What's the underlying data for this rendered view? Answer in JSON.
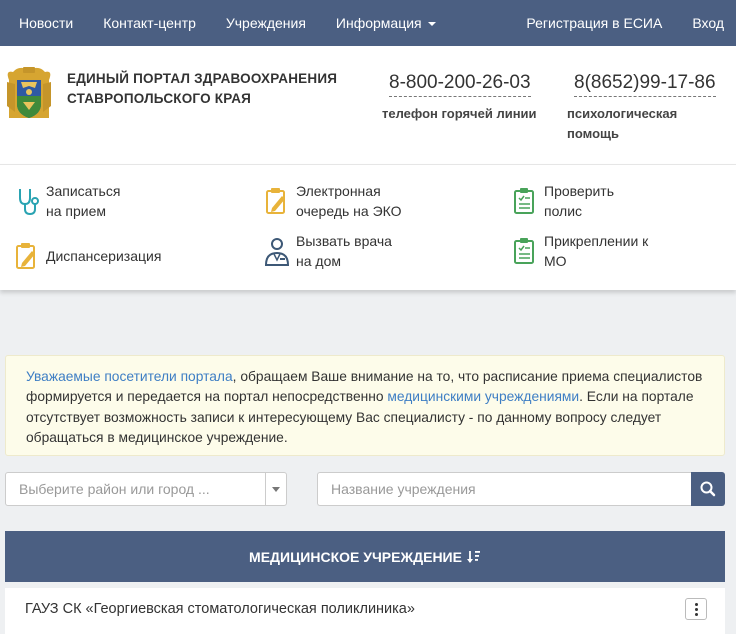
{
  "nav": {
    "items": [
      "Новости",
      "Контакт-центр",
      "Учреждения",
      "Информация"
    ],
    "registration": "Регистрация в ЕСИА",
    "login": "Вход"
  },
  "header": {
    "title_line1": "ЕДИНЫЙ ПОРТАЛ ЗДРАВООХРАНЕНИЯ",
    "title_line2": "СТАВРОПОЛЬСКОГО КРАЯ",
    "hotline_phone": "8-800-200-26-03",
    "hotline_caption": "телефон горячей линии",
    "psych_phone": "8(8652)99-17-86",
    "psych_caption_line1": "психологическая",
    "psych_caption_line2": "помощь"
  },
  "services": [
    {
      "line1": "Записаться",
      "line2": "на прием"
    },
    {
      "line1": "Электронная",
      "line2": "очередь на ЭКО"
    },
    {
      "line1": "Проверить",
      "line2": "полис"
    },
    {
      "line1": "Диспансеризация",
      "line2": ""
    },
    {
      "line1": "Вызвать врача",
      "line2": "на дом"
    },
    {
      "line1": "Прикреплении к",
      "line2": "МО"
    }
  ],
  "notice": {
    "link1": "Уважаемые посетители портала",
    "text1": ", обращаем Ваше внимание на то, что расписание приема специалистов формируется и передается на портал непосредственно ",
    "link2": "медицинскими учреждениями",
    "text2": ". Если на портале отсутствует возможность записи к интересующему Вас специалисту - по данному вопросу следует обращаться в медицинское учреждение."
  },
  "filters": {
    "district_placeholder": "Выберите район или город ...",
    "name_placeholder": "Название учреждения"
  },
  "table": {
    "header": "МЕДИЦИНСКОЕ УЧРЕЖДЕНИЕ",
    "rows": [
      "ГАУЗ СК «Георгиевская стоматологическая поликлиника»"
    ]
  },
  "colors": {
    "nav_bg": "#4b5f82",
    "link": "#3e7ec4",
    "icon_teal": "#2aa3b2",
    "icon_yellow": "#e8b33a",
    "icon_green": "#49a35a",
    "icon_navy": "#3d5876"
  },
  "icons": [
    "stethoscope-icon",
    "clipboard-pen-icon",
    "clipboard-check-icon",
    "doctor-icon",
    "search-icon",
    "sort-icon",
    "kebab-menu-icon",
    "coat-of-arms-emblem"
  ]
}
